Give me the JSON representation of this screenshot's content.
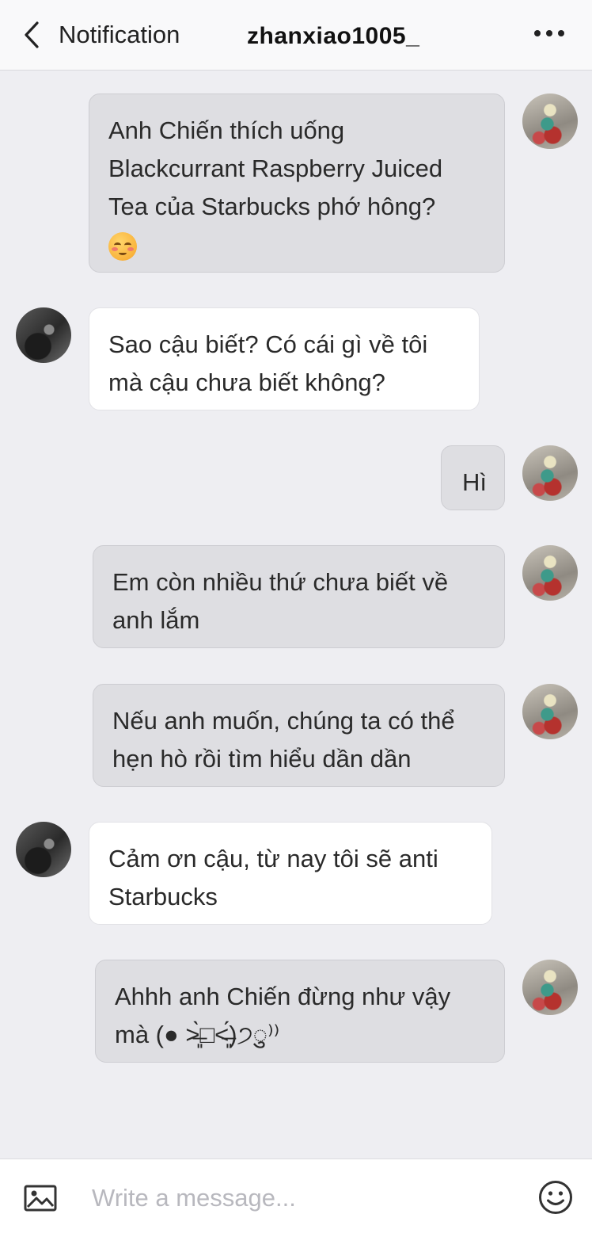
{
  "header": {
    "back_label": "Notification",
    "title": "zhanxiao1005_"
  },
  "messages": [
    {
      "side": "out",
      "text": "Anh Chiến thích uống Blackcurrant Raspberry Juiced Tea của Starbucks phớ hông?",
      "emoji": "relieved-face-emoji"
    },
    {
      "side": "in",
      "text": "Sao cậu biết? Có cái gì về tôi mà cậu chưa biết không?"
    },
    {
      "side": "out",
      "text": "Hì"
    },
    {
      "side": "out",
      "text": "Em còn nhiều thứ chưa biết về anh lắm"
    },
    {
      "side": "out",
      "text": "Nếu anh muốn, chúng ta có thể hẹn hò rồi tìm hiểu dần dần"
    },
    {
      "side": "in",
      "text": "Cảm ơn cậu, từ nay tôi sẽ anti Starbucks"
    },
    {
      "side": "out",
      "text": "Ahhh anh Chiến đừng như vậy mà (● ˃̶͈̀□˂̶͈́)੭ु⁾⁾"
    }
  ],
  "composer": {
    "placeholder": "Write a message..."
  },
  "icons": {
    "back": "chevron-left-icon",
    "more": "more-horizontal-icon",
    "image": "image-icon",
    "emoji": "smile-icon"
  }
}
